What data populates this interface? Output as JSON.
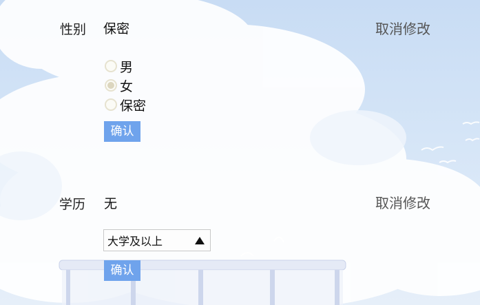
{
  "gender": {
    "label": "性别",
    "value": "保密",
    "cancel_label": "取消修改",
    "options": [
      {
        "label": "男",
        "checked": false
      },
      {
        "label": "女",
        "checked": true
      },
      {
        "label": "保密",
        "checked": false
      }
    ],
    "confirm_label": "确认"
  },
  "education": {
    "label": "学历",
    "value": "无",
    "cancel_label": "取消修改",
    "select_value": "大学及以上",
    "confirm_label": "确认"
  },
  "colors": {
    "button_bg": "#6fa3ec",
    "sky": "#c8dcf4"
  }
}
